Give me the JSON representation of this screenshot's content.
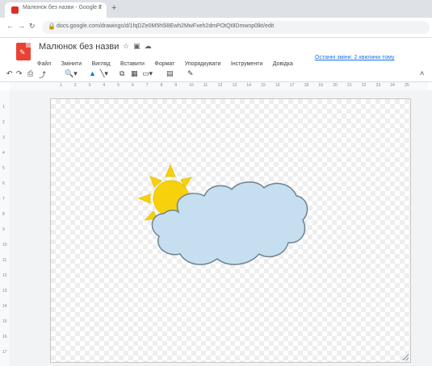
{
  "browser": {
    "tab_title": "Малюнок без назви - Google Т",
    "tab_close": "×",
    "new_tab": "+",
    "nav": {
      "back": "←",
      "forward": "→",
      "reload": "↻"
    },
    "url": "docs.google.com/drawings/d/1fqDZe0M5h5l8Ewh2MwFxeh2dmPOtQt9Dmwnp0lkt/edit"
  },
  "app": {
    "logo_glyph": "✎",
    "doc_title": "Малюнок без назви",
    "header_icons": {
      "star": "☆",
      "move": "▣",
      "cloud": "☁"
    },
    "menu": [
      "Файл",
      "Змінити",
      "Вигляд",
      "Вставити",
      "Формат",
      "Упорядкувати",
      "Інструменти",
      "Довідка"
    ],
    "last_edit": "Останні зміни: 2 хвилини тому"
  },
  "toolbar": {
    "undo": "↶",
    "redo": "↷",
    "print": "⎙",
    "paint": "⤴",
    "zoom": "🔍▾",
    "select": "▲",
    "line": "╲▾",
    "shape": "⧉",
    "image": "▦",
    "more": "▭▾",
    "comment": "▤",
    "pen": "✎",
    "collapse": "˄"
  },
  "ruler": {
    "h_labels": [
      "1",
      "2",
      "3",
      "4",
      "5",
      "6",
      "7",
      "8",
      "9",
      "10",
      "11",
      "12",
      "13",
      "14",
      "15",
      "16",
      "17",
      "18",
      "19",
      "20",
      "21",
      "22",
      "23",
      "24",
      "25"
    ],
    "v_labels": [
      "1",
      "2",
      "3",
      "4",
      "5",
      "6",
      "7",
      "8",
      "9",
      "10",
      "11",
      "12",
      "13",
      "14",
      "15",
      "16",
      "17"
    ]
  },
  "colors": {
    "sun": "#f7d20c",
    "sun_stroke": "#e8c40a",
    "cloud": "#c6dff0",
    "cloud_stroke": "#6e8290"
  }
}
